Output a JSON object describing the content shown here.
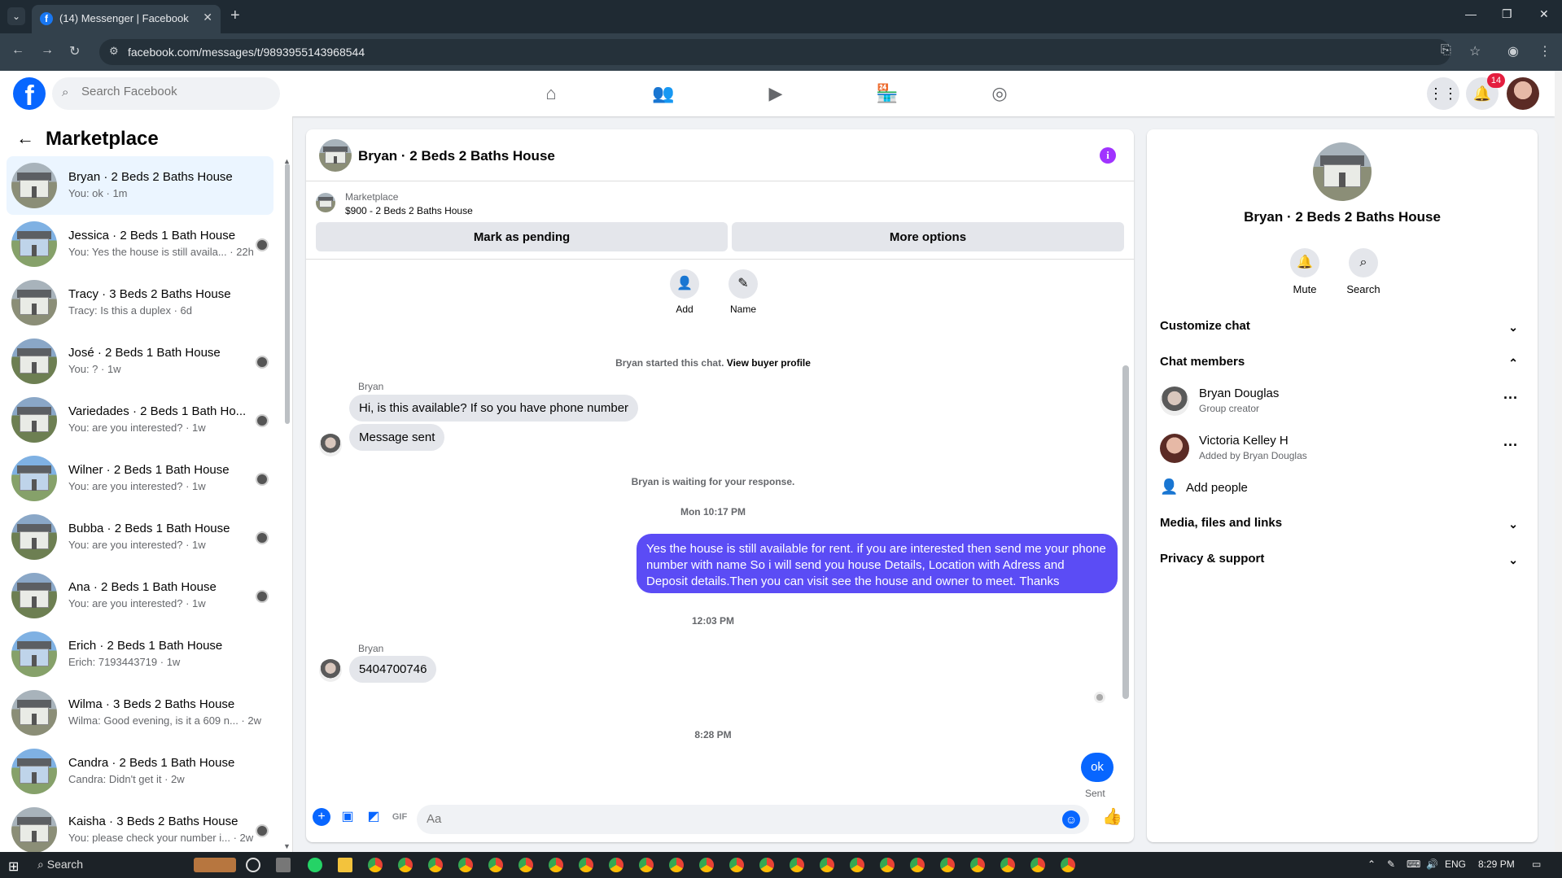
{
  "browser": {
    "tab_title": "(14) Messenger | Facebook",
    "url": "facebook.com/messages/t/9893955143968544"
  },
  "fb": {
    "search_placeholder": "Search Facebook",
    "notification_count": "14"
  },
  "sidebar": {
    "title": "Marketplace",
    "conversations": [
      {
        "name": "Bryan · 2 Beds 2 Baths House",
        "snippet": "You: ok · 1m",
        "active": true
      },
      {
        "name": "Jessica · 2 Beds 1 Bath House",
        "snippet": "You: Yes the house is still availa... · 22h"
      },
      {
        "name": "Tracy · 3 Beds 2 Baths House",
        "snippet": "Tracy: Is this a duplex · 6d"
      },
      {
        "name": "José · 2 Beds 1 Bath House",
        "snippet": "You: ? · 1w"
      },
      {
        "name": "Variedades · 2 Beds 1 Bath Ho...",
        "snippet": "You: are you interested? · 1w"
      },
      {
        "name": "Wilner · 2 Beds 1 Bath House",
        "snippet": "You: are you interested? · 1w"
      },
      {
        "name": "Bubba · 2 Beds 1 Bath House",
        "snippet": "You: are you interested? · 1w"
      },
      {
        "name": "Ana · 2 Beds 1 Bath House",
        "snippet": "You: are you interested? · 1w"
      },
      {
        "name": "Erich · 2 Beds 1 Bath House",
        "snippet": "Erich: 7193443719 · 1w"
      },
      {
        "name": "Wilma · 3 Beds 2 Baths House",
        "snippet": "Wilma: Good evening, is it a 609 n... · 2w"
      },
      {
        "name": "Candra · 2 Beds 1 Bath House",
        "snippet": "Candra: Didn't get it · 2w"
      },
      {
        "name": "Kaisha · 3 Beds 2 Baths House",
        "snippet": "You: please check your number i... · 2w"
      }
    ]
  },
  "chat": {
    "title": "Bryan · 2 Beds 2 Baths House",
    "marketplace_label": "Marketplace",
    "listing": "$900 - 2 Beds 2 Baths House",
    "mark_pending": "Mark as pending",
    "more_options": "More options",
    "add_label": "Add",
    "name_label": "Name",
    "started_text": "Bryan started this chat.",
    "view_profile": "View buyer profile",
    "sender": "Bryan",
    "msg1": "Hi, is this available? If so you have phone number",
    "msg2": "Message sent",
    "waiting": "Bryan is waiting for your response.",
    "time1": "Mon 10:17 PM",
    "reply_line1": "Yes the house is still available for rent. if you are interested then send me your phone",
    "reply_line2": "number with name So i will send you house Details, Location with Adress and",
    "reply_line3": "Deposit details.Then you can visit see the house and owner to meet. Thanks",
    "time2": "12:03 PM",
    "msg3": "5404700746",
    "time3": "8:28 PM",
    "ok": "ok",
    "sent": "Sent",
    "composer_placeholder": "Aa"
  },
  "right": {
    "title": "Bryan · 2 Beds 2 Baths House",
    "mute": "Mute",
    "search": "Search",
    "customize": "Customize chat",
    "members": "Chat members",
    "member1_name": "Bryan Douglas",
    "member1_sub": "Group creator",
    "member2_name": "Victoria Kelley H",
    "member2_sub": "Added by Bryan Douglas",
    "add_people": "Add people",
    "media": "Media, files and links",
    "privacy": "Privacy & support"
  },
  "taskbar": {
    "search": "Search",
    "lang": "ENG",
    "time": "8:29 PM"
  }
}
